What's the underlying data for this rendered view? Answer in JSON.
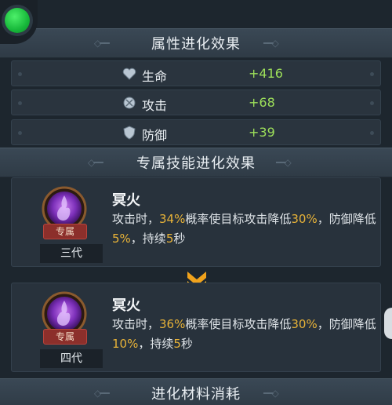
{
  "attributes": {
    "title": "属性进化效果",
    "stats": [
      {
        "label": "生命",
        "value": "+416",
        "icon": "heart-icon"
      },
      {
        "label": "攻击",
        "value": "+68",
        "icon": "attack-icon"
      },
      {
        "label": "防御",
        "value": "+39",
        "icon": "shield-icon"
      }
    ]
  },
  "skills": {
    "title": "专属技能进化效果",
    "cards": [
      {
        "name": "冥火",
        "tag": "专属",
        "generation": "三代",
        "desc_parts": [
          "攻击时，",
          "34%",
          "概率使目标攻击降低",
          "30%",
          "，防御降低",
          "5%",
          "，持续",
          "5",
          "秒"
        ]
      },
      {
        "name": "冥火",
        "tag": "专属",
        "generation": "四代",
        "desc_parts": [
          "攻击时，",
          "36%",
          "概率使目标攻击降低",
          "30%",
          "，防御降低",
          "10%",
          "，持续",
          "5",
          "秒"
        ]
      }
    ]
  },
  "materials": {
    "title": "进化材料消耗"
  },
  "colors": {
    "stat_value": "#9de05a",
    "highlight": "#e8b338",
    "tag_red": "#8c2f2b"
  }
}
